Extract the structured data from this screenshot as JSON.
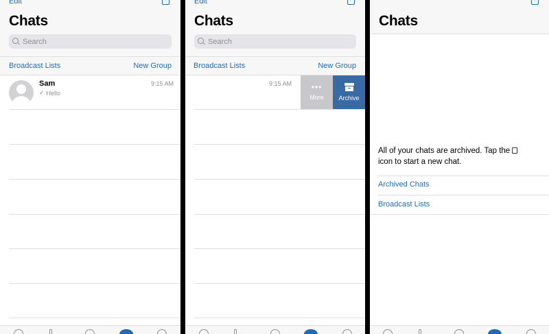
{
  "panels": [
    {
      "edit_label": "Edit",
      "title": "Chats",
      "search_placeholder": "Search",
      "broadcast_label": "Broadcast Lists",
      "new_group_label": "New Group",
      "chat": {
        "name": "Sam",
        "message": "Hello",
        "time": "9:15 AM"
      }
    },
    {
      "edit_label": "Edit",
      "title": "Chats",
      "search_placeholder": "Search",
      "broadcast_label": "Broadcast Lists",
      "new_group_label": "New Group",
      "chat": {
        "time": "9:15 AM"
      },
      "swipe_actions": {
        "more": "More",
        "archive": "Archive"
      }
    },
    {
      "title": "Chats",
      "empty_message": "All of your chats are archived. Tap the",
      "empty_message_end": "icon to start a new chat.",
      "archived_chats_label": "Archived Chats",
      "broadcast_label": "Broadcast Lists"
    }
  ],
  "colors": {
    "link": "#1f6bb5",
    "archive_action": "#3a6aa3",
    "more_action": "#c7c7cc",
    "background": "#f7f7f7"
  },
  "icons": [
    "compose-icon",
    "search-icon",
    "avatar",
    "check-icon",
    "more-dots-icon",
    "archive-icon"
  ]
}
